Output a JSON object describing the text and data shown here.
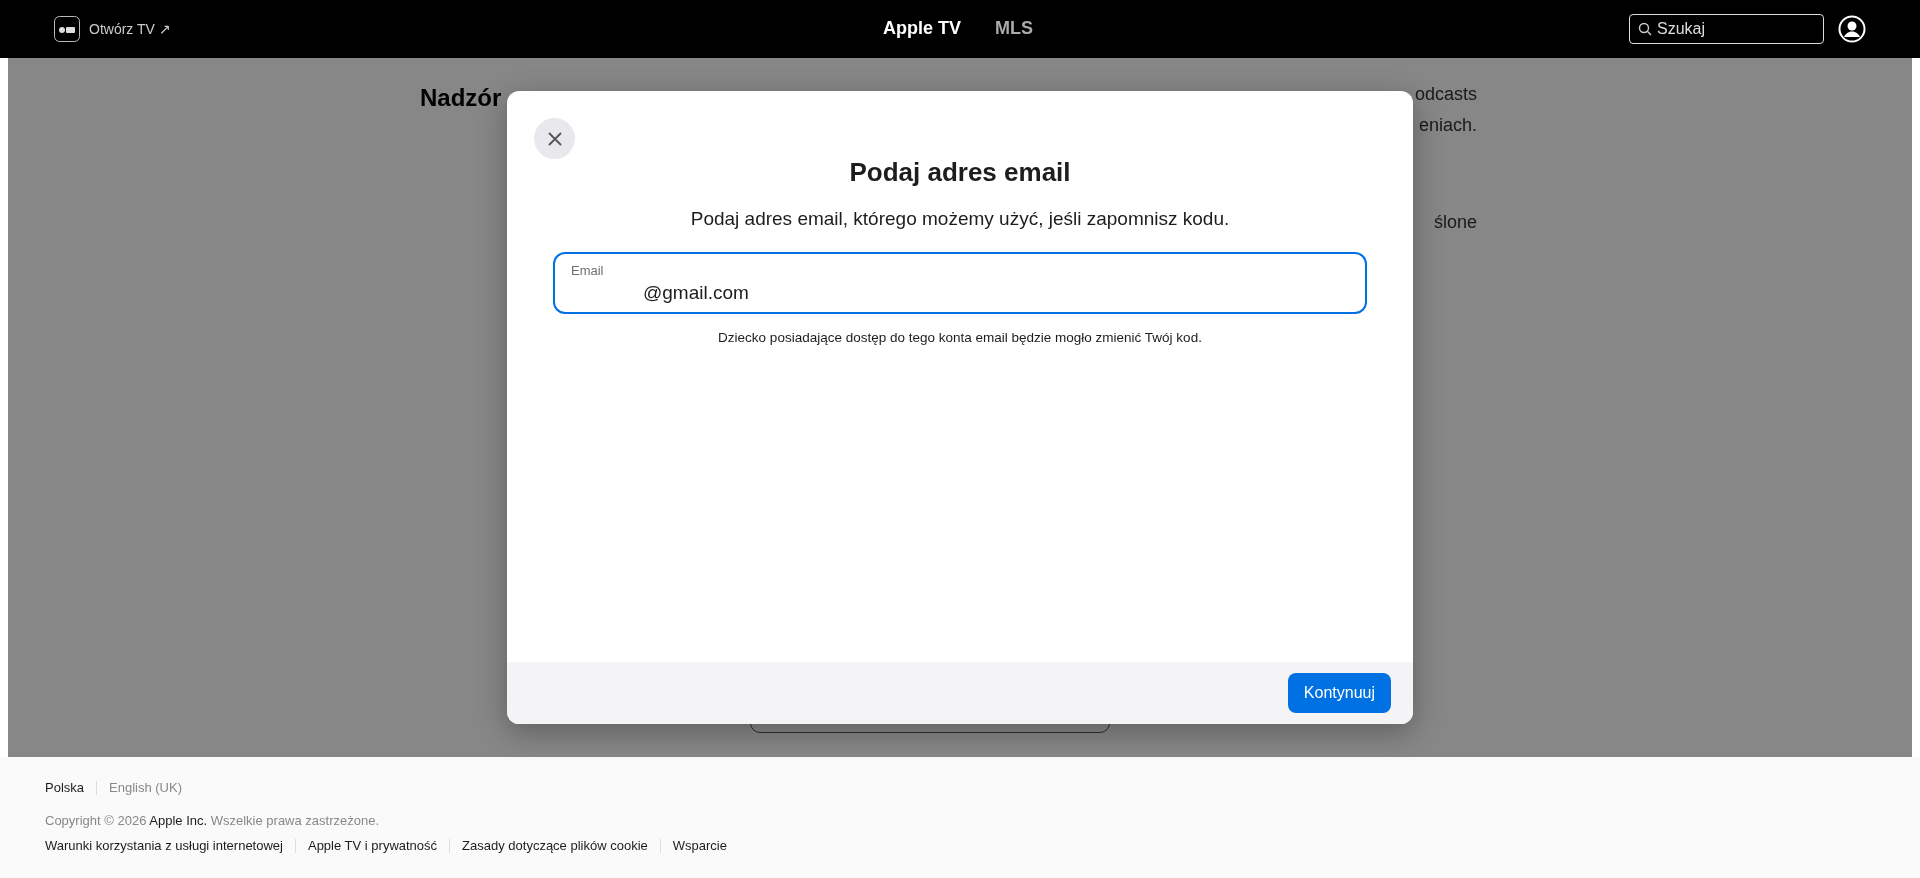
{
  "header": {
    "open_tv": "Otwórz TV ↗",
    "nav": [
      {
        "label": "Apple TV",
        "selected": true
      },
      {
        "label": "MLS",
        "selected": false
      }
    ],
    "search": {
      "placeholder": "Szukaj"
    }
  },
  "background_page": {
    "heading": "Nadzór",
    "text_fragments": [
      "odcasts",
      "eniach.",
      "ślone"
    ]
  },
  "dialog": {
    "title": "Podaj adres email",
    "subtitle": "Podaj adres email, którego możemy użyć, jeśli zapomnisz kodu.",
    "email_field": {
      "label": "Email",
      "value": "@gmail.com",
      "focused": true
    },
    "note": "Dziecko posiadające dostęp do tego konta email będzie mogło zmienić Twój kod.",
    "continue_button": "Kontynuuj"
  },
  "footer": {
    "languages": [
      {
        "label": "Polska",
        "selected": true
      },
      {
        "label": "English (UK)",
        "selected": false
      }
    ],
    "copyright": "Copyright © 2026 **Apple Inc.** Wszelkie prawa zastrzeżone.",
    "links": [
      "Warunki korzystania z usługi internetowej",
      "Apple TV i prywatność",
      "Zasady dotyczące plików cookie",
      "Wsparcie"
    ]
  }
}
